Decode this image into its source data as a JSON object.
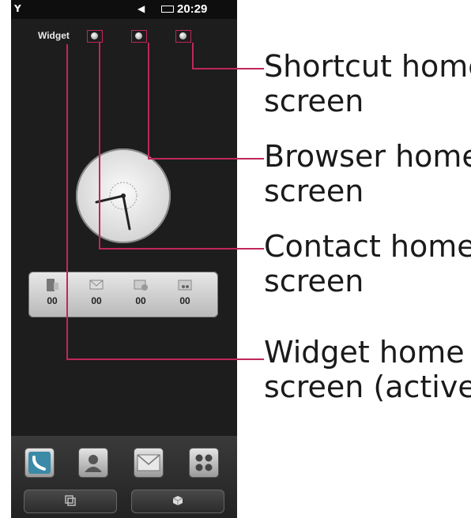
{
  "status_bar": {
    "time": "20:29"
  },
  "indicator": {
    "active_label": "Widget"
  },
  "counters": [
    {
      "icon": "call-log-icon",
      "value": "00"
    },
    {
      "icon": "message-icon",
      "value": "00"
    },
    {
      "icon": "email-icon",
      "value": "00"
    },
    {
      "icon": "voicemail-icon",
      "value": "00"
    }
  ],
  "dock": [
    {
      "icon": "phone-icon"
    },
    {
      "icon": "contacts-icon"
    },
    {
      "icon": "messaging-icon"
    },
    {
      "icon": "menu-grid-icon"
    }
  ],
  "soft_keys": [
    {
      "icon": "multitask-icon"
    },
    {
      "icon": "cube-icon"
    }
  ],
  "callouts": {
    "shortcut": [
      "Shortcut home",
      "screen"
    ],
    "browser": [
      "Browser home",
      "screen"
    ],
    "contact": [
      "Contact home",
      "screen"
    ],
    "widget": [
      "Widget home",
      "screen (active)"
    ]
  },
  "colors": {
    "callout_line": "#c0265a",
    "screen_bg": "#1d1d1d"
  }
}
